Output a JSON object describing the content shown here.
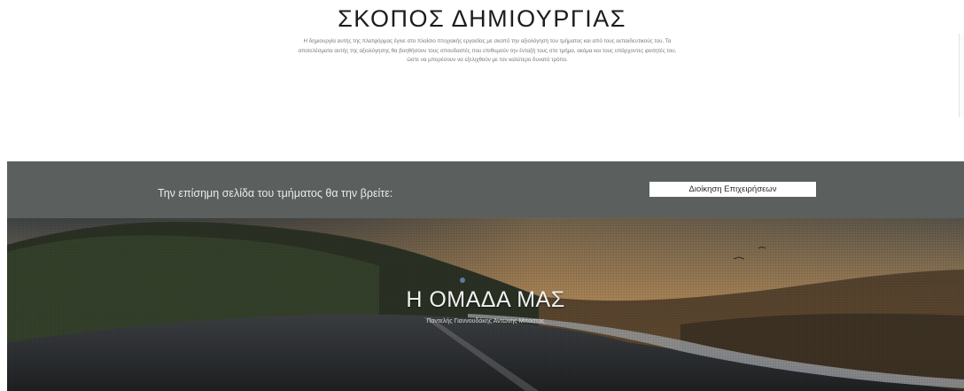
{
  "purpose": {
    "title": "ΣΚΟΠΟΣ ΔΗΜΙΟΥΡΓΙΑΣ",
    "text": "Η δημιουργία αυτής της πλατφόρμας έγινε στο πλαίσιο πτυχιακής εργασίας με σκοπό την αξιολόγηση του τμήματος και από τους εκπαιδευτικούς του. Τα αποτελέσματα αυτής της αξιολόγησης θα βοηθήσουν τους σπουδαστές που επιθυμούν την ένταξή τους στο τμήμα, ακόμα και τους υπάρχοντες φοιτητές του, ώστε να μπορέσουν να εξελιχθούν με τον καλύτερο δυνατό τρόπο."
  },
  "official": {
    "text": "Την επίσημη σελίδα του τμήματος θα την βρείτε:",
    "button_label": "Διοίκηση Επιχειρήσεων"
  },
  "team": {
    "title": "Η ΟΜΑΔΑ ΜΑΣ",
    "members": "Παντελής Γιαννουδάκης   Αντώνης Μπαστας"
  },
  "colors": {
    "band": "#5b605f",
    "button_bg": "#ffffff",
    "title_text": "#1c1c1c"
  }
}
